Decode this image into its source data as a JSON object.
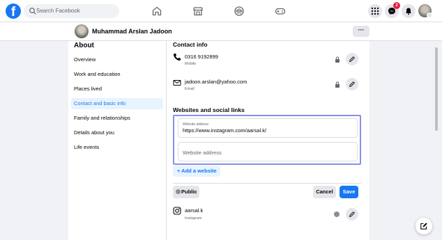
{
  "topbar": {
    "search_placeholder": "Search Facebook",
    "notification_count": "2",
    "icons": [
      "facebook-logo",
      "home-icon",
      "marketplace-icon",
      "groups-icon",
      "gaming-icon",
      "menu-grid-icon",
      "messenger-icon",
      "bell-icon"
    ]
  },
  "profile": {
    "name": "Muhammad Arslan Jadoon",
    "more_label": "···"
  },
  "about": {
    "title": "About",
    "items": [
      {
        "label": "Overview"
      },
      {
        "label": "Work and education"
      },
      {
        "label": "Places lived"
      },
      {
        "label": "Contact and basic info"
      },
      {
        "label": "Family and relationships"
      },
      {
        "label": "Details about you"
      },
      {
        "label": "Life events"
      }
    ],
    "active_index": 3
  },
  "contact": {
    "heading": "Contact info",
    "phone": {
      "value": "0316 9192899",
      "type": "Mobile"
    },
    "email": {
      "value": "jadoon.arslan@yahoo.com",
      "type": "Email"
    }
  },
  "websites": {
    "heading": "Websites and social links",
    "field1": {
      "label": "Website address",
      "value": "https://www.instagram.com/aarsal.k/"
    },
    "field2": {
      "placeholder": "Website address"
    },
    "add_label": "+ Add a website",
    "public_label": "Public",
    "cancel_label": "Cancel",
    "save_label": "Save",
    "instagram": {
      "value": "aarsal.k",
      "type": "Instagram"
    }
  },
  "colors": {
    "brand_blue": "#1877f2",
    "highlight_border": "#8b8ee8",
    "active_bg": "#e7f3ff",
    "badge_red": "#e41e3f"
  }
}
